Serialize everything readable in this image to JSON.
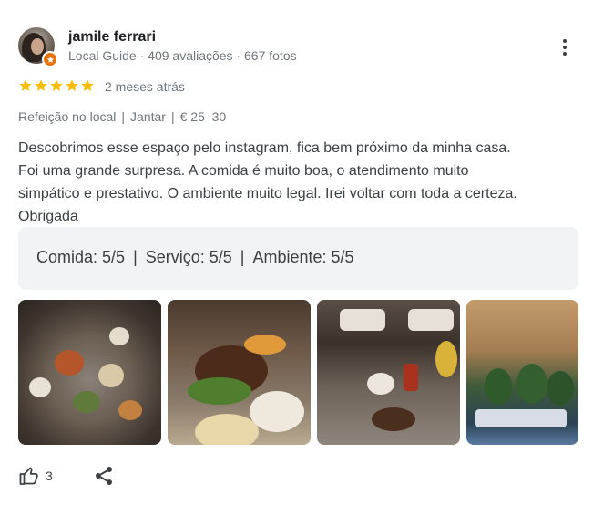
{
  "reviewer": {
    "name": "jamile ferrari",
    "meta": "Local Guide · 409 avaliações · 667 fotos",
    "avatar_icon": "user-avatar",
    "badge_icon": "local-guide-star-icon",
    "badge_color": "#e8710a"
  },
  "rating": {
    "stars": 5,
    "star_color": "#fbbc04",
    "date": "2 meses atrás"
  },
  "tags": [
    "Refeição no local",
    "Jantar",
    "€ 25–30"
  ],
  "review_text": [
    "Descobrimos esse espaço pelo instagram, fica bem próximo da minha casa.",
    "Foi uma grande surpresa. A comida é muito boa, o atendimento muito",
    "simpático e prestativo. O ambiente muito legal. Irei voltar com toda a certeza.",
    "Obrigada"
  ],
  "sub_ratings": {
    "comida": "Comida: 5/5",
    "servico": "Serviço: 5/5",
    "ambiente": "Ambiente: 5/5",
    "separator": "|"
  },
  "photos": [
    "photo-table-dishes",
    "photo-meat-platter",
    "photo-restaurant-interior",
    "photo-terrace-view"
  ],
  "actions": {
    "like_count": "3",
    "like_icon": "thumbs-up-icon",
    "share_icon": "share-icon",
    "menu_icon": "more-vert-icon"
  }
}
